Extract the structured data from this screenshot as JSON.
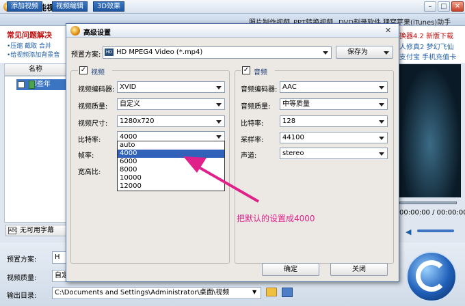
{
  "app": {
    "title": "狸窝全能视频转换器"
  },
  "tabs": [
    {
      "label": "添加视频"
    },
    {
      "label": "视频编辑"
    },
    {
      "label": "3D效果"
    }
  ],
  "top_links": [
    {
      "label": "照片制作视频"
    },
    {
      "label": "PPT转换视频"
    },
    {
      "label": "DVD刻录软件"
    },
    {
      "label": "狸窝苹果(iTunes)助手"
    }
  ],
  "faq": {
    "title": "常见问题解决",
    "line1": "•压缩  截取  合并",
    "line2": "•给视频添加背景音"
  },
  "list": {
    "header": "名称",
    "item": "那些年"
  },
  "subtitle": {
    "label": "无可用字幕",
    "icon": "ABC"
  },
  "bottom": {
    "preset_label": "预置方案:",
    "preset_value": "H",
    "quality_label": "视频质量:",
    "quality_value": "自定",
    "output_label": "输出目录:",
    "output_value": "C:\\Documents and Settings\\Administrator\\桌面\\视频"
  },
  "promo": {
    "line1": "换器4.2  新版下载",
    "line2": "人修真2  梦幻飞仙",
    "line3": "支付宝  手机充值卡",
    "colors": {
      "red": "#c01010",
      "blue": "#1f5fa8"
    }
  },
  "player": {
    "timecode": "00:00:00 / 00:00:00"
  },
  "dialog": {
    "title": "高级设置",
    "close": "✕",
    "preset_label": "预置方案:",
    "preset_badge": "HD",
    "preset_value": "HD MPEG4 Video (*.mp4)",
    "save_as": "保存为",
    "video": {
      "header": "视频",
      "checked": "✓",
      "codec_label": "视频编码器:",
      "codec": "XVID",
      "quality_label": "视频质量:",
      "quality": "自定义",
      "size_label": "视频尺寸:",
      "size": "1280x720",
      "bitrate_label": "比特率:",
      "bitrate": "4000",
      "fps_label": "帧率:",
      "aspect_label": "宽高比:",
      "bitrate_options": [
        "auto",
        "4000",
        "6000",
        "8000",
        "10000",
        "12000"
      ],
      "bitrate_selected": "4000"
    },
    "audio": {
      "header": "音频",
      "checked": "✓",
      "codec_label": "音频编码器:",
      "codec": "AAC",
      "quality_label": "音频质量:",
      "quality": "中等质量",
      "bitrate_label": "比特率:",
      "bitrate": "128",
      "samplerate_label": "采样率:",
      "samplerate": "44100",
      "channel_label": "声道:",
      "channel": "stereo"
    },
    "ok": "确定",
    "close_button": "关闭"
  },
  "annotation": {
    "text": "把默认的设置成4000",
    "color": "#e0218a"
  }
}
